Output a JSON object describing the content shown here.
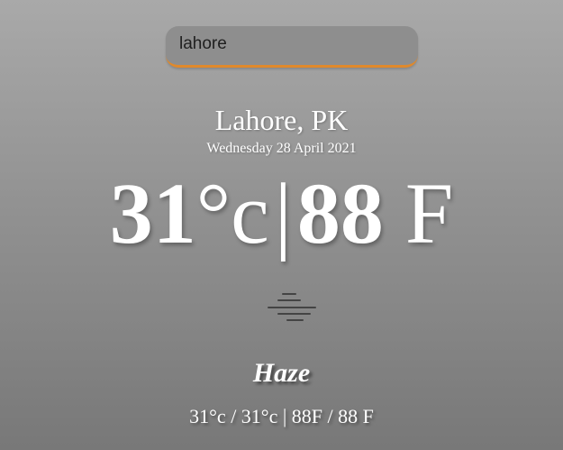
{
  "search": {
    "value": "lahore"
  },
  "location": {
    "city_country": "Lahore, PK",
    "date": "Wednesday 28 April 2021"
  },
  "current": {
    "temp_c": "31",
    "unit_c": "°c",
    "separator": "|",
    "temp_f": "88",
    "unit_f": "F"
  },
  "condition": {
    "icon": "haze-icon",
    "label": "Haze"
  },
  "range": {
    "text": "31°c / 31°c | 88F / 88 F"
  },
  "colors": {
    "accent": "#e0892b",
    "text": "#ffffff"
  }
}
